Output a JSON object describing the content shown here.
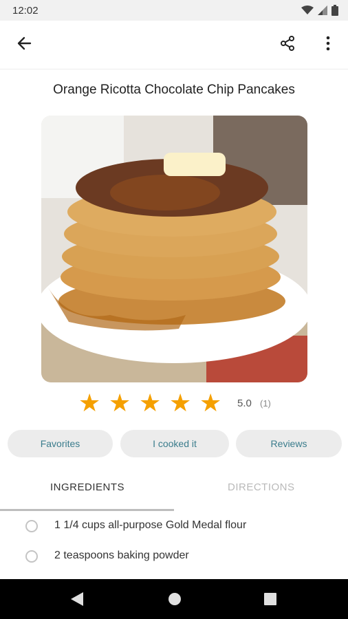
{
  "status": {
    "time": "12:02",
    "icons": [
      "wifi-icon",
      "signal-icon",
      "battery-icon"
    ]
  },
  "toolbar": {
    "back_icon": "arrow-left-icon",
    "share_icon": "share-icon",
    "menu_icon": "more-vert-icon"
  },
  "recipe": {
    "title": "Orange Ricotta Chocolate Chip Pancakes",
    "rating": {
      "stars": 5,
      "max": 5,
      "value_label": "5.0",
      "count_label": "(1)"
    }
  },
  "actions": {
    "favorites": "Favorites",
    "cooked": "I cooked it",
    "reviews": "Reviews"
  },
  "tabs": {
    "ingredients": "INGREDIENTS",
    "directions": "DIRECTIONS",
    "active": "ingredients"
  },
  "ingredients": [
    "1 1/4 cups all-purpose Gold Medal flour",
    "2 teaspoons baking powder"
  ],
  "colors": {
    "accent": "#f5a000",
    "button_text": "#3a7c8c",
    "button_bg": "#ececec"
  }
}
